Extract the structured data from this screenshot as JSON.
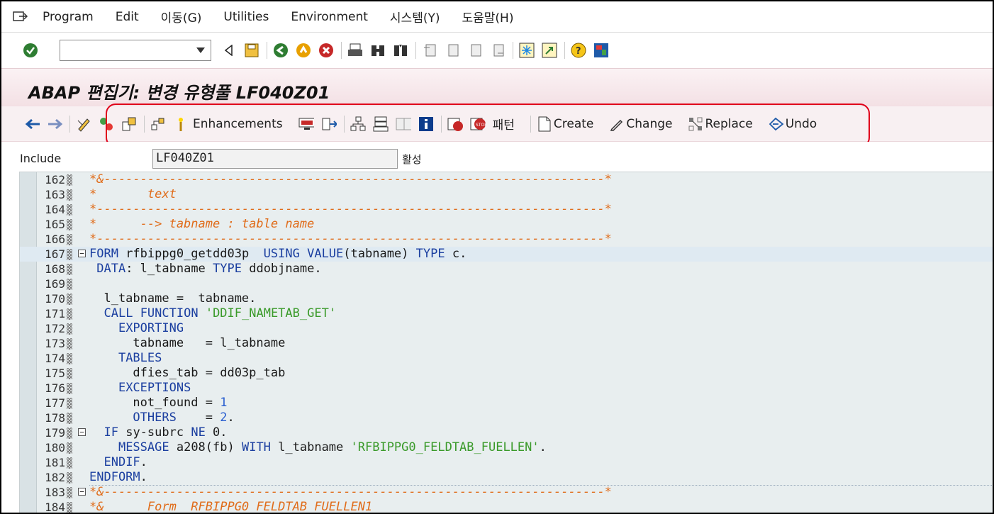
{
  "menu": {
    "items": [
      "Program",
      "Edit",
      "이동(G)",
      "Utilities",
      "Environment",
      "시스템(Y)",
      "도움말(H)"
    ]
  },
  "title": "ABAP 편집기: 변경 유형풀 LF040Z01",
  "app_toolbar": {
    "enhancements": "Enhancements",
    "pattern": "패턴",
    "create": "Create",
    "change": "Change",
    "replace": "Replace",
    "undo": "Undo"
  },
  "include": {
    "label": "Include",
    "value": "LF040Z01",
    "status": "활성"
  },
  "code_lines": [
    {
      "n": "162",
      "text": "*&---------------------------------------------------------------------*"
    },
    {
      "n": "163",
      "text": "*       text"
    },
    {
      "n": "164",
      "text": "*----------------------------------------------------------------------*"
    },
    {
      "n": "165",
      "text": "*      --> tabname : table name"
    },
    {
      "n": "166",
      "text": "*----------------------------------------------------------------------*"
    },
    {
      "n": "167",
      "text": "FORM rfbippg0_getdd03p  USING VALUE(tabname) TYPE c."
    },
    {
      "n": "168",
      "text": " DATA: l_tabname TYPE ddobjname."
    },
    {
      "n": "169",
      "text": ""
    },
    {
      "n": "170",
      "text": "  l_tabname =  tabname."
    },
    {
      "n": "171",
      "text": "  CALL FUNCTION 'DDIF_NAMETAB_GET'"
    },
    {
      "n": "172",
      "text": "    EXPORTING"
    },
    {
      "n": "173",
      "text": "      tabname   = l_tabname"
    },
    {
      "n": "174",
      "text": "    TABLES"
    },
    {
      "n": "175",
      "text": "      dfies_tab = dd03p_tab"
    },
    {
      "n": "176",
      "text": "    EXCEPTIONS"
    },
    {
      "n": "177",
      "text": "      not_found = 1"
    },
    {
      "n": "178",
      "text": "      OTHERS    = 2."
    },
    {
      "n": "179",
      "text": "  IF sy-subrc NE 0."
    },
    {
      "n": "180",
      "text": "    MESSAGE a208(fb) WITH l_tabname 'RFBIPPG0_FELDTAB_FUELLEN'."
    },
    {
      "n": "181",
      "text": "  ENDIF."
    },
    {
      "n": "182",
      "text": "ENDFORM."
    },
    {
      "n": "183",
      "text": "*&---------------------------------------------------------------------*"
    },
    {
      "n": "184",
      "text": "*&      Form  RFBIPPG0_FELDTAB_FUELLEN1"
    }
  ]
}
